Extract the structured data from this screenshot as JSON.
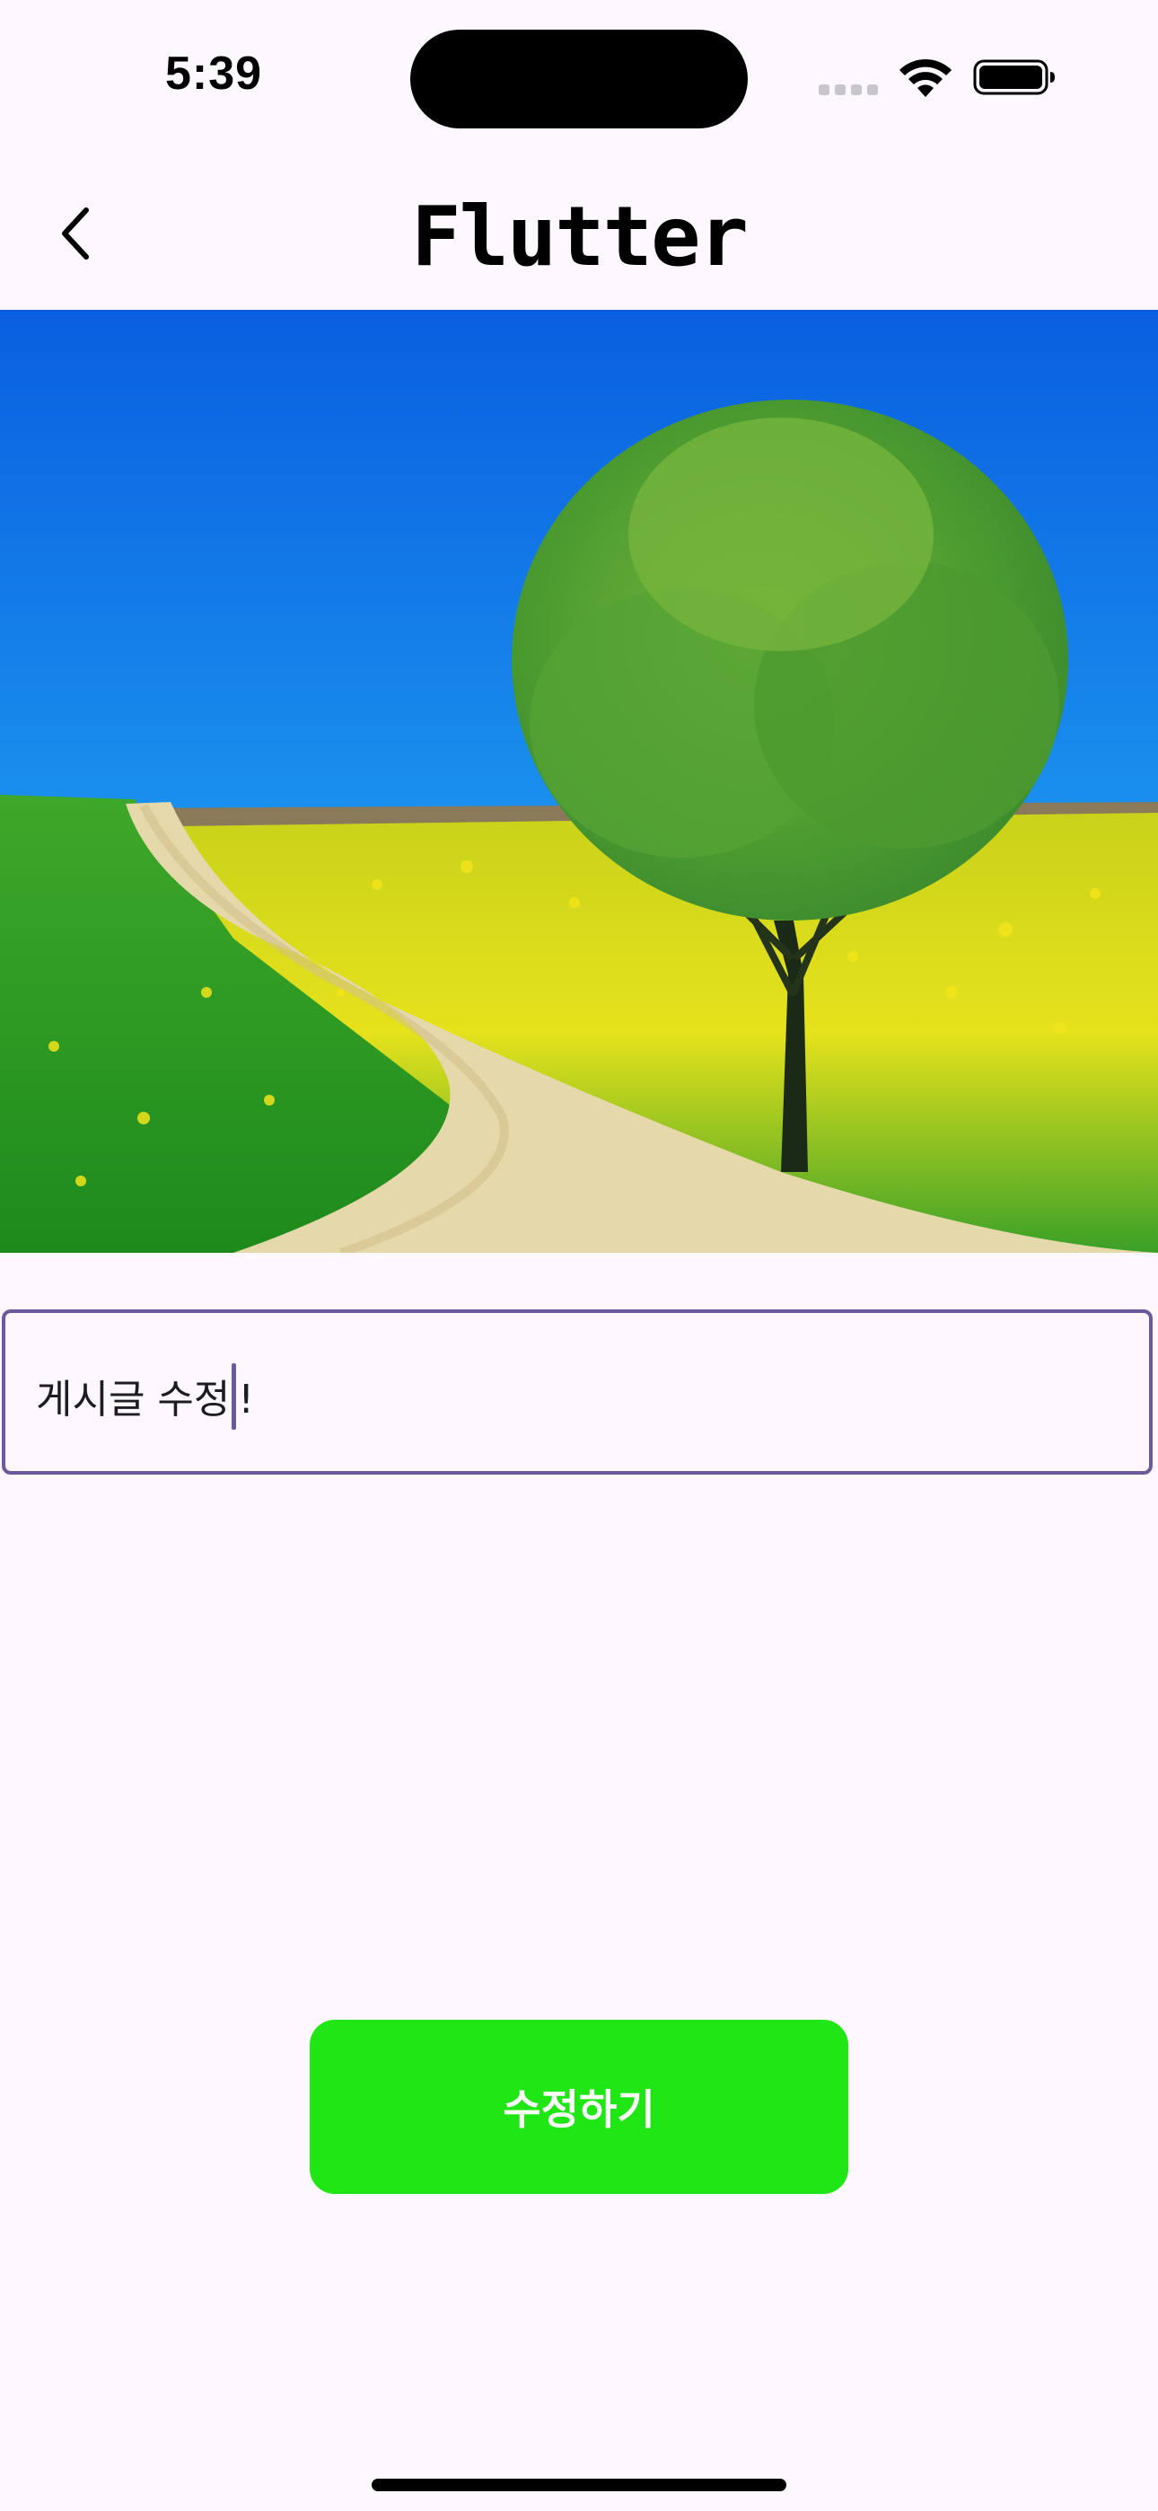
{
  "status_bar": {
    "time": "5:39",
    "icons": [
      "cellular-signal-icon",
      "wifi-icon",
      "battery-icon"
    ]
  },
  "header": {
    "title": "Flutter",
    "back_icon": "chevron-left-icon"
  },
  "post": {
    "image": "landscape photo: tree on grassy hill with dirt path and yellow flowers under blue sky"
  },
  "editor": {
    "text_before_caret": "게시글 수정",
    "text_after_caret": "!",
    "border_color": "#6a5a9c"
  },
  "actions": {
    "submit_label": "수정하기",
    "submit_color": "#1fe614"
  },
  "colors": {
    "background": "#fdf8fd",
    "accent": "#6a5a9c"
  }
}
